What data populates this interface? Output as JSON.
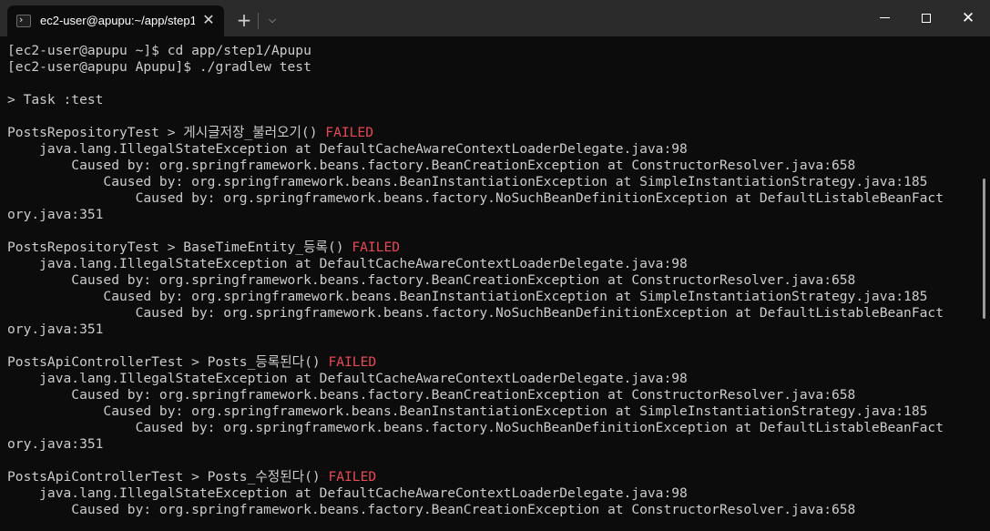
{
  "window": {
    "tab_title": "ec2-user@apupu:~/app/step1",
    "tab_close_glyph": "✕",
    "new_tab_glyph": "+",
    "dropdown_glyph": "⌵",
    "tab_icon": "powershell-icon",
    "close_glyph": "✕"
  },
  "terminal": {
    "lines": [
      {
        "text": "[ec2-user@apupu ~]$ cd app/step1/Apupu"
      },
      {
        "text": "[ec2-user@apupu Apupu]$ ./gradlew test"
      },
      {
        "text": ""
      },
      {
        "text": "> Task :test"
      },
      {
        "text": ""
      },
      {
        "text": "PostsRepositoryTest > 게시글저장_불러오기() ",
        "status": "FAILED"
      },
      {
        "text": "    java.lang.IllegalStateException at DefaultCacheAwareContextLoaderDelegate.java:98"
      },
      {
        "text": "        Caused by: org.springframework.beans.factory.BeanCreationException at ConstructorResolver.java:658"
      },
      {
        "text": "            Caused by: org.springframework.beans.BeanInstantiationException at SimpleInstantiationStrategy.java:185"
      },
      {
        "text": "                Caused by: org.springframework.beans.factory.NoSuchBeanDefinitionException at DefaultListableBeanFact"
      },
      {
        "text": "ory.java:351"
      },
      {
        "text": ""
      },
      {
        "text": "PostsRepositoryTest > BaseTimeEntity_등록() ",
        "status": "FAILED"
      },
      {
        "text": "    java.lang.IllegalStateException at DefaultCacheAwareContextLoaderDelegate.java:98"
      },
      {
        "text": "        Caused by: org.springframework.beans.factory.BeanCreationException at ConstructorResolver.java:658"
      },
      {
        "text": "            Caused by: org.springframework.beans.BeanInstantiationException at SimpleInstantiationStrategy.java:185"
      },
      {
        "text": "                Caused by: org.springframework.beans.factory.NoSuchBeanDefinitionException at DefaultListableBeanFact"
      },
      {
        "text": "ory.java:351"
      },
      {
        "text": ""
      },
      {
        "text": "PostsApiControllerTest > Posts_등록된다() ",
        "status": "FAILED"
      },
      {
        "text": "    java.lang.IllegalStateException at DefaultCacheAwareContextLoaderDelegate.java:98"
      },
      {
        "text": "        Caused by: org.springframework.beans.factory.BeanCreationException at ConstructorResolver.java:658"
      },
      {
        "text": "            Caused by: org.springframework.beans.BeanInstantiationException at SimpleInstantiationStrategy.java:185"
      },
      {
        "text": "                Caused by: org.springframework.beans.factory.NoSuchBeanDefinitionException at DefaultListableBeanFact"
      },
      {
        "text": "ory.java:351"
      },
      {
        "text": ""
      },
      {
        "text": "PostsApiControllerTest > Posts_수정된다() ",
        "status": "FAILED"
      },
      {
        "text": "    java.lang.IllegalStateException at DefaultCacheAwareContextLoaderDelegate.java:98"
      },
      {
        "text": "        Caused by: org.springframework.beans.factory.BeanCreationException at ConstructorResolver.java:658"
      }
    ]
  },
  "colors": {
    "background": "#0c0c0c",
    "foreground": "#cccccc",
    "failed": "#e74856",
    "titlebar": "#2b2b2b"
  }
}
